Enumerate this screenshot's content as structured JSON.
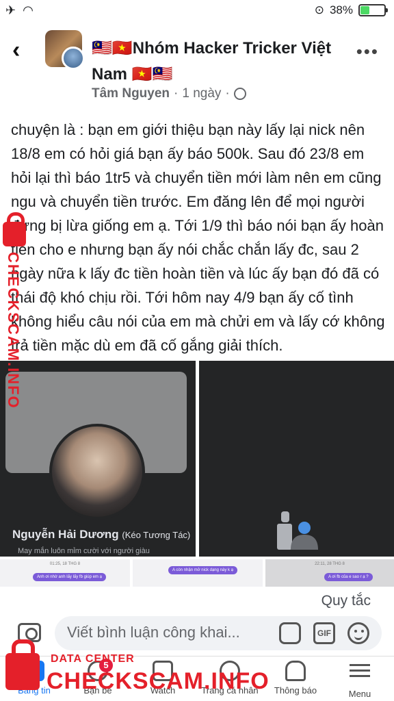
{
  "status_bar": {
    "battery": "38%",
    "battery_level": 0.38
  },
  "header": {
    "group_name": "🇲🇾🇻🇳Nhóm Hacker Tricker Việt Nam 🇻🇳🇲🇾",
    "author": "Tâm Nguyen",
    "separator": "·",
    "time": "1 ngày"
  },
  "post": {
    "text": "chuyện là : bạn em giới thiệu bạn này lấy lại nick nên 18/8 em có hỏi giá bạn ấy báo 500k. Sau đó 23/8 em hỏi lại thì báo 1tr5 và chuyển tiền mới làm nên em cũng ngu và chuyển tiền trước. Em đăng lên để mọi người đừng bị lừa giống em ạ. Tới 1/9 thì báo nói bạn ấy hoàn tiền cho e nhưng bạn ấy nói chắc chắn lấy đc, sau 2 ngày nữa k lấy đc tiền hoàn tiền và lúc ấy bạn đó đã có thái độ khó chịu rồi. Tới hôm nay 4/9 bạn ấy cố tình không hiểu câu nói của em mà chửi em và lấy cớ không trả tiền mặc dù em đã cố gắng giải thích.",
    "profile_card": {
      "name": "Nguyễn Hải Dương",
      "name_suffix": "(Kéo Tương Tác)",
      "bio": "May mắn luôn mỉm cười với người giàu"
    },
    "thumbnails": [
      {
        "time": "01:25, 18 THG 8",
        "message": "Anh ơi nhờ anh lấy lấy fb giúp em ạ"
      },
      {
        "time": "",
        "message": "A còn nhận mở nick dạng này k ạ"
      },
      {
        "time": "22:11, 28 THG 8",
        "message": "A ơi fb của e sao r ạ ?"
      }
    ]
  },
  "rules_link": "Quy tắc",
  "composer": {
    "placeholder": "Viết bình luận công khai...",
    "gif_label": "GIF"
  },
  "bottom_nav": [
    {
      "label": "Bảng tin",
      "active": true
    },
    {
      "label": "Bạn bè",
      "badge": "5"
    },
    {
      "label": "Watch"
    },
    {
      "label": "Trang cá nhân"
    },
    {
      "label": "Thông báo"
    },
    {
      "label": "Menu"
    }
  ],
  "watermark": {
    "side_text": "CHECKSCAM.INFO",
    "data_center": "DATA CENTER",
    "brand": "CHECKSCAM.INFO"
  },
  "colors": {
    "accent": "#1877f2",
    "watermark": "#e4202a",
    "badge": "#e41e3f"
  }
}
